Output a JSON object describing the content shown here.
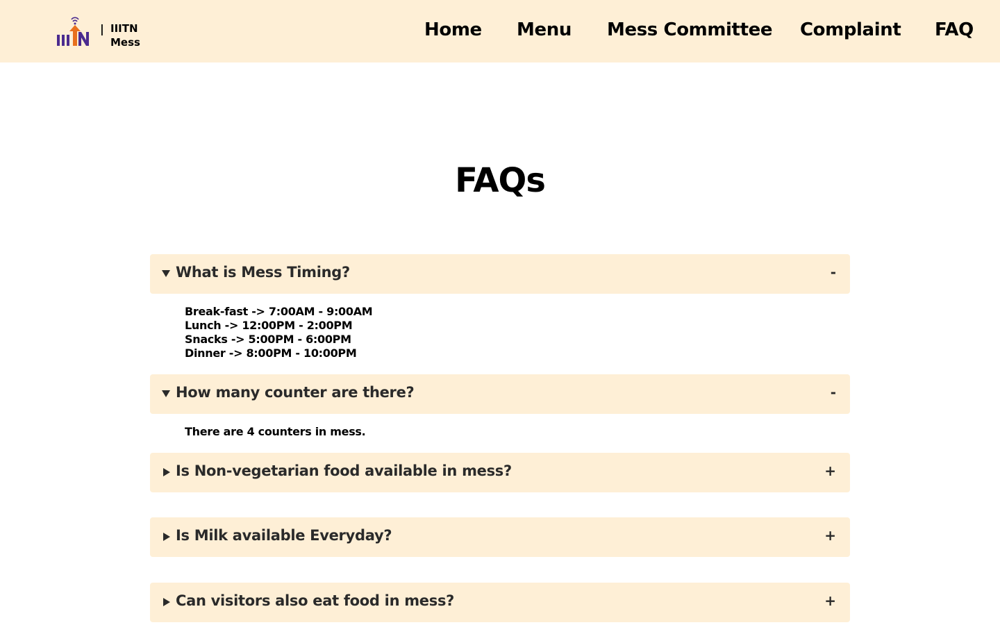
{
  "header": {
    "brand_separator": "|",
    "brand_line1": "IIITN",
    "brand_line2": "Mess",
    "nav": [
      {
        "label": "Home"
      },
      {
        "label": "Menu"
      },
      {
        "label": "Mess Committee"
      },
      {
        "label": "Complaint"
      },
      {
        "label": "FAQ"
      }
    ]
  },
  "main": {
    "title": "FAQs",
    "faqs": [
      {
        "question": "What is Mess Timing?",
        "toggle": "-",
        "expanded": true,
        "answer_lines": [
          "Break-fast -> 7:00AM - 9:00AM",
          "Lunch -> 12:00PM - 2:00PM",
          "Snacks -> 5:00PM - 6:00PM",
          "Dinner -> 8:00PM - 10:00PM"
        ]
      },
      {
        "question": "How many counter are there?",
        "toggle": "-",
        "expanded": true,
        "answer_lines": [
          "There are 4 counters in mess."
        ]
      },
      {
        "question": "Is Non-vegetarian food available in mess?",
        "toggle": "+",
        "expanded": false
      },
      {
        "question": "Is Milk available Everyday?",
        "toggle": "+",
        "expanded": false
      },
      {
        "question": "Can visitors also eat food in mess?",
        "toggle": "+",
        "expanded": false
      }
    ]
  },
  "colors": {
    "header_bg": "#feefd6",
    "faq_bg": "#feefd6",
    "logo_purple": "#4b2b8f",
    "logo_orange": "#e8701d"
  }
}
